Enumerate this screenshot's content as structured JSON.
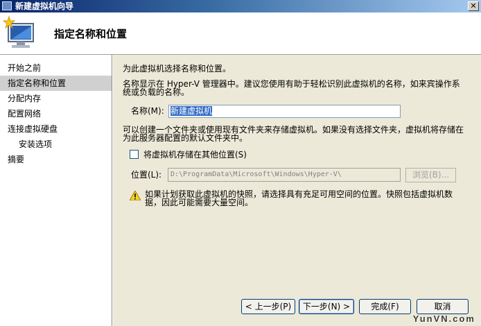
{
  "window": {
    "title": "新建虚拟机向导",
    "close_glyph": "✕"
  },
  "header": {
    "title": "指定名称和位置"
  },
  "sidebar": {
    "items": [
      {
        "label": "开始之前"
      },
      {
        "label": "指定名称和位置",
        "active": true
      },
      {
        "label": "分配内存"
      },
      {
        "label": "配置网络"
      },
      {
        "label": "连接虚拟硬盘"
      },
      {
        "label": "安装选项"
      },
      {
        "label": "摘要"
      }
    ]
  },
  "main": {
    "intro": "为此虚拟机选择名称和位置。",
    "description_line1": "名称显示在 Hyper-V 管理器中。建议您使用有助于轻松识别此虚拟机的名称，如来宾操作系",
    "description_line2": "统或负载的名称。",
    "name_label": "名称(M):",
    "name_value": "新建虚拟机",
    "folder_info_line1": "可以创建一个文件夹或使用现有文件夹来存储虚拟机。如果没有选择文件夹，虚拟机将存储在",
    "folder_info_line2": "为此服务器配置的默认文件夹中。",
    "store_elsewhere_label": "将虚拟机存储在其他位置(S)",
    "store_elsewhere_checked": false,
    "location_label": "位置(L):",
    "location_value": "D:\\ProgramData\\Microsoft\\Windows\\Hyper-V\\",
    "browse_label": "浏览(B)...",
    "warning_line1": "如果计划获取此虚拟机的快照，请选择具有充足可用空间的位置。快照包括虚拟机数",
    "warning_line2": "据，因此可能需要大量空间。"
  },
  "buttons": {
    "previous": "< 上一步(P)",
    "next": "下一步(N) >",
    "finish": "完成(F)",
    "cancel": "取消"
  },
  "watermark": "YunVN.com",
  "colors": {
    "titlebar_start": "#0a246a",
    "selection": "#316ac5",
    "panel": "#ece9d8"
  }
}
